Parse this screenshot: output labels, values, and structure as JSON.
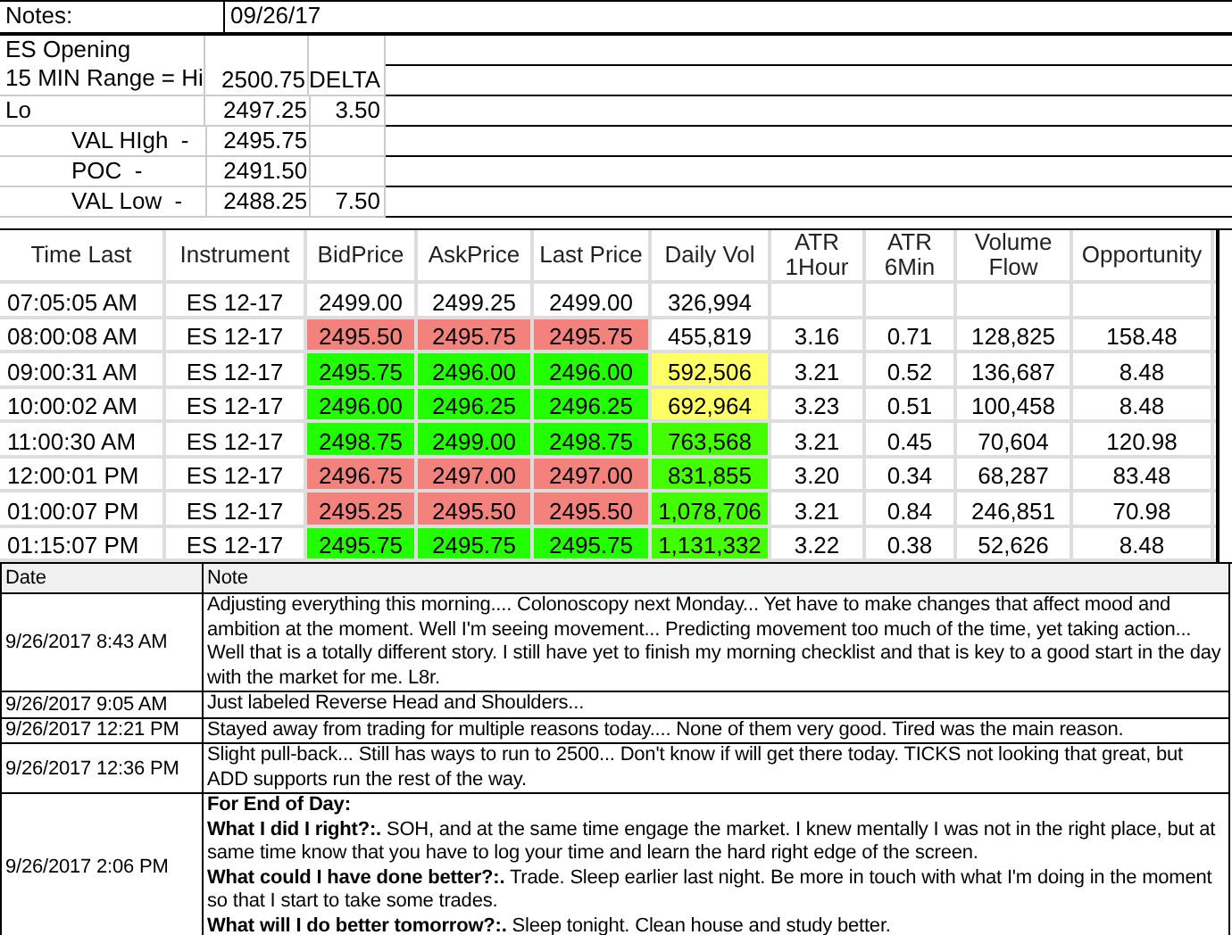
{
  "header": {
    "label": "Notes:",
    "date": "09/26/17"
  },
  "opening": {
    "title": "ES Opening",
    "levels": [
      {
        "kind": "main",
        "label": "15 MIN Range = Hi",
        "value": "2500.75",
        "extra": "DELTA"
      },
      {
        "kind": "main",
        "label": "Lo",
        "value": "2497.25",
        "extra": "3.50"
      },
      {
        "kind": "sub",
        "label": "VAL HIgh  -",
        "value": "2495.75"
      },
      {
        "kind": "sub",
        "label": "POC  -",
        "value": "2491.50"
      },
      {
        "kind": "sub",
        "label": "VAL Low  -",
        "value": "2488.25",
        "extra": "7.50"
      }
    ]
  },
  "quotes": {
    "columns": [
      "Time Last",
      "Instrument",
      "BidPrice",
      "AskPrice",
      "Last Price",
      "Daily Vol",
      "ATR 1Hour",
      "ATR 6Min",
      "Volume Flow",
      "Opportunity"
    ],
    "rows": [
      {
        "cells": [
          {
            "text": "07:05:05 AM"
          },
          {
            "text": "ES 12-17"
          },
          {
            "text": "2499.00"
          },
          {
            "text": "2499.25"
          },
          {
            "text": "2499.00"
          },
          {
            "text": "326,994"
          }
        ]
      },
      {
        "cells": [
          {
            "text": "08:00:08 AM"
          },
          {
            "text": "ES 12-17"
          },
          {
            "text": "2495.50",
            "color": "#f4827c"
          },
          {
            "text": "2495.75",
            "color": "#f4827c"
          },
          {
            "text": "2495.75",
            "color": "#f4827c"
          },
          {
            "text": "455,819"
          },
          {
            "text": "3.16"
          },
          {
            "text": "0.71"
          },
          {
            "text": "128,825"
          },
          {
            "text": "158.48"
          }
        ]
      },
      {
        "cells": [
          {
            "text": "09:00:31 AM"
          },
          {
            "text": "ES 12-17"
          },
          {
            "text": "2495.75",
            "color": "#22ff00"
          },
          {
            "text": "2496.00",
            "color": "#22ff00"
          },
          {
            "text": "2496.00",
            "color": "#22ff00"
          },
          {
            "text": "592,506",
            "color": "#ffff66"
          },
          {
            "text": "3.21"
          },
          {
            "text": "0.52"
          },
          {
            "text": "136,687"
          },
          {
            "text": "8.48"
          }
        ]
      },
      {
        "cells": [
          {
            "text": "10:00:02 AM"
          },
          {
            "text": "ES 12-17"
          },
          {
            "text": "2496.00",
            "color": "#22ff00"
          },
          {
            "text": "2496.25",
            "color": "#22ff00"
          },
          {
            "text": "2496.25",
            "color": "#22ff00"
          },
          {
            "text": "692,964",
            "color": "#ffff66"
          },
          {
            "text": "3.23"
          },
          {
            "text": "0.51"
          },
          {
            "text": "100,458"
          },
          {
            "text": "8.48"
          }
        ]
      },
      {
        "cells": [
          {
            "text": "11:00:30 AM"
          },
          {
            "text": "ES 12-17"
          },
          {
            "text": "2498.75",
            "color": "#22ff00"
          },
          {
            "text": "2499.00",
            "color": "#22ff00"
          },
          {
            "text": "2498.75",
            "color": "#22ff00"
          },
          {
            "text": "763,568",
            "color": "#44ff00"
          },
          {
            "text": "3.21"
          },
          {
            "text": "0.45"
          },
          {
            "text": "70,604"
          },
          {
            "text": "120.98"
          }
        ]
      },
      {
        "cells": [
          {
            "text": "12:00:01 PM"
          },
          {
            "text": "ES 12-17"
          },
          {
            "text": "2496.75",
            "color": "#f4827c"
          },
          {
            "text": "2497.00",
            "color": "#f4827c"
          },
          {
            "text": "2497.00",
            "color": "#f4827c"
          },
          {
            "text": "831,855",
            "color": "#44ff00"
          },
          {
            "text": "3.20"
          },
          {
            "text": "0.34"
          },
          {
            "text": "68,287"
          },
          {
            "text": "83.48"
          }
        ]
      },
      {
        "cells": [
          {
            "text": "01:00:07 PM"
          },
          {
            "text": "ES 12-17"
          },
          {
            "text": "2495.25",
            "color": "#f4827c"
          },
          {
            "text": "2495.50",
            "color": "#f4827c"
          },
          {
            "text": "2495.50",
            "color": "#f4827c"
          },
          {
            "text": "1,078,706",
            "color": "#44ff00"
          },
          {
            "text": "3.21"
          },
          {
            "text": "0.84"
          },
          {
            "text": "246,851"
          },
          {
            "text": "70.98"
          }
        ]
      },
      {
        "cells": [
          {
            "text": "01:15:07 PM"
          },
          {
            "text": "ES 12-17"
          },
          {
            "text": "2495.75",
            "color": "#22ff00"
          },
          {
            "text": "2495.75",
            "color": "#22ff00"
          },
          {
            "text": "2495.75",
            "color": "#22ff00"
          },
          {
            "text": "1,131,332",
            "color": "#44ff00"
          },
          {
            "text": "3.22"
          },
          {
            "text": "0.38"
          },
          {
            "text": "52,626"
          },
          {
            "text": "8.48"
          }
        ]
      }
    ]
  },
  "journal": {
    "columns": [
      "Date",
      "Note"
    ],
    "rows": [
      {
        "date": "9/26/2017 8:43 AM",
        "lines": [
          "Adjusting everything this morning.... Colonoscopy next Monday... Yet have to make changes that affect mood and ambition at the moment.  Well I'm seeing movement... Predicting movement too much of the time, yet taking action... Well that is a totally different story.  I still have yet to finish my morning checklist and that is key to a good start in the day with the market for me.  L8r."
        ]
      },
      {
        "date": "9/26/2017 9:05 AM",
        "lines": [
          "Just labeled Reverse Head and Shoulders..."
        ]
      },
      {
        "date": "9/26/2017 12:21 PM",
        "lines": [
          "Stayed away from trading for multiple reasons today.... None of them very good.  Tired was the main reason."
        ]
      },
      {
        "date": "9/26/2017 12:36 PM",
        "lines": [
          "Slight pull-back... Still has ways to run to 2500... Don't know if will get there today.  TICKS not looking that great, but ADD supports run the rest of the way."
        ]
      },
      {
        "date": "9/26/2017 2:06 PM",
        "lines": [
          "**For End of Day:**",
          "**What I did I right?:.** SOH, and at the same time engage the market.  I knew mentally I was not in the right place, but at same time know that you have to log your time and learn the hard right edge of the screen.",
          "**What could I have done better?:.** Trade.  Sleep earlier last night.  Be more in touch with what I'm doing in the moment so that I start to take some trades.",
          "**What will I do better tomorrow?:.**  Sleep tonight.  Clean house and study better."
        ]
      }
    ]
  }
}
